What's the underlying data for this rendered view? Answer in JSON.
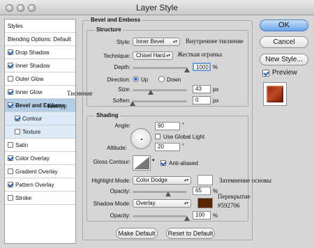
{
  "title": "Layer Style",
  "left_panel": {
    "items": [
      {
        "label": "Styles",
        "checkbox": false,
        "checked": false
      },
      {
        "label": "Blending Options: Default",
        "checkbox": false,
        "checked": false
      },
      {
        "label": "Drop Shadow",
        "checkbox": true,
        "checked": true
      },
      {
        "label": "Inner Shadow",
        "checkbox": true,
        "checked": true
      },
      {
        "label": "Outer Glow",
        "checkbox": true,
        "checked": false
      },
      {
        "label": "Inner Glow",
        "checkbox": true,
        "checked": true
      },
      {
        "label": "Bevel and Emboss",
        "checkbox": true,
        "checked": true
      },
      {
        "label": "Contour",
        "checkbox": true,
        "checked": true
      },
      {
        "label": "Texture",
        "checkbox": true,
        "checked": false
      },
      {
        "label": "Satin",
        "checkbox": true,
        "checked": false
      },
      {
        "label": "Color Overlay",
        "checkbox": true,
        "checked": true
      },
      {
        "label": "Gradient Overlay",
        "checkbox": true,
        "checked": false
      },
      {
        "label": "Pattern Overlay",
        "checkbox": true,
        "checked": true
      },
      {
        "label": "Stroke",
        "checkbox": true,
        "checked": false
      }
    ]
  },
  "bevel": {
    "group_title": "Bevel and Emboss",
    "structure": {
      "title": "Structure",
      "style_label": "Style:",
      "style_value": "Inner Bevel",
      "technique_label": "Technique:",
      "technique_value": "Chisel Hard",
      "depth_label": "Depth:",
      "depth_value": "1000",
      "depth_unit": "%",
      "depth_level": 1.0,
      "direction_label": "Direction:",
      "direction_up": "Up",
      "direction_down": "Down",
      "direction_selected": "Up",
      "size_label": "Size:",
      "size_value": "43",
      "size_unit": "px",
      "soften_label": "Soften:",
      "soften_value": "0",
      "soften_unit": "px"
    },
    "shading": {
      "title": "Shading",
      "angle_label": "Angle:",
      "angle_value": "90",
      "angle_unit": "°",
      "use_global_light": "Use Global Light",
      "use_global_light_checked": false,
      "altitude_label": "Altitude:",
      "altitude_value": "20",
      "altitude_unit": "°",
      "gloss_contour_label": "Gloss Contour:",
      "anti_aliased": "Anti-aliased",
      "anti_aliased_checked": true,
      "highlight_mode_label": "Highlight Mode:",
      "highlight_mode_value": "Color Dodge",
      "highlight_color": "#ffffff",
      "highlight_opacity_label": "Opacity:",
      "highlight_opacity_value": "65",
      "highlight_opacity_unit": "%",
      "shadow_mode_label": "Shadow Mode:",
      "shadow_mode_value": "Overlay",
      "shadow_color": "#592706",
      "shadow_opacity_label": "Opacity:",
      "shadow_opacity_value": "100",
      "shadow_opacity_unit": "%"
    },
    "make_default": "Make Default",
    "reset_default": "Reset to Default"
  },
  "right_panel": {
    "ok": "OK",
    "cancel": "Cancel",
    "new_style": "New Style...",
    "preview": "Preview",
    "preview_checked": true
  },
  "annotations": {
    "inner_bevel": "Внутреннее тиснение",
    "chisel_hard": "Жесткая огранка",
    "emboss": "Тиснение",
    "contour": "Контур",
    "highlight": "Затемнение основы",
    "shadow_line1": "Перекрытие",
    "shadow_line2": "#592706"
  }
}
